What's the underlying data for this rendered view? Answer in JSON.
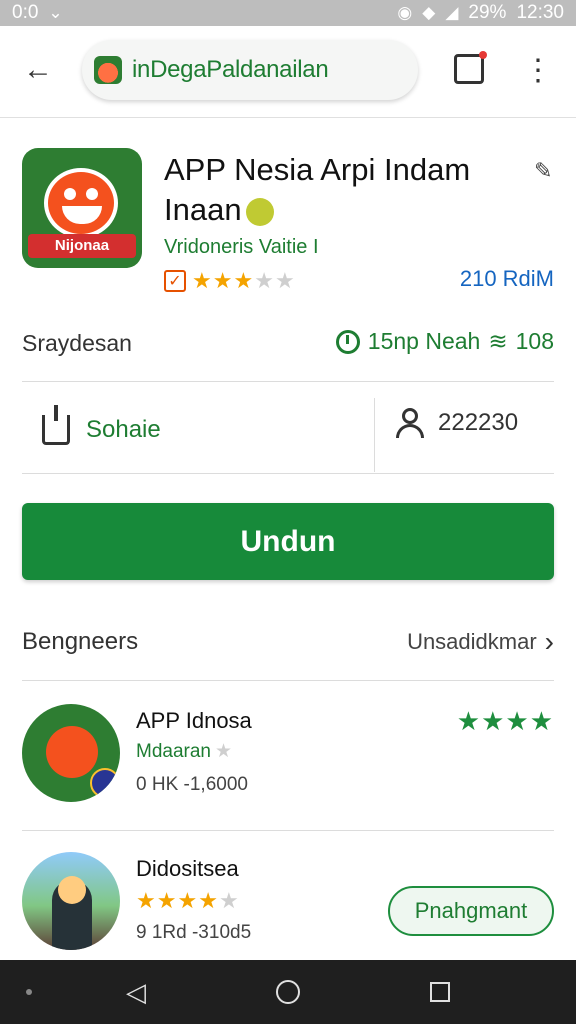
{
  "status_bar": {
    "left_text": "0:0",
    "right_battery": "29%",
    "time": "12:30"
  },
  "browser": {
    "url_text": "inDegaPaldanailan",
    "back_icon": "back-arrow-icon",
    "menu_icon": "more-vert-icon"
  },
  "app": {
    "title": "APP Nesia Arpi Indam Inaan",
    "icon_banner": "Nijonaa",
    "developer": "Vridoneris Vaitie I",
    "rating_stars": 3,
    "rating_max": 5,
    "reviews": "210 RdiM",
    "stat_left": "Sraydesan",
    "stat_right": "15np Neah",
    "stat_right_count": "108",
    "share_label": "Sohaie",
    "users_count": "222230",
    "install_label": "Undun"
  },
  "section": {
    "title": "Bengneers",
    "link": "Unsadidkmar"
  },
  "list": [
    {
      "name": "APP Idnosa",
      "sub": "Mdaaran",
      "meta": "0 HK -1,6000",
      "stars": 4
    },
    {
      "name": "Didositsea",
      "meta": "9 1Rd -310d5",
      "stars": 4,
      "button": "Pnahgmant"
    }
  ],
  "colors": {
    "accent_green": "#178a3a",
    "link_blue": "#1565c0",
    "star_orange": "#f4a300"
  }
}
